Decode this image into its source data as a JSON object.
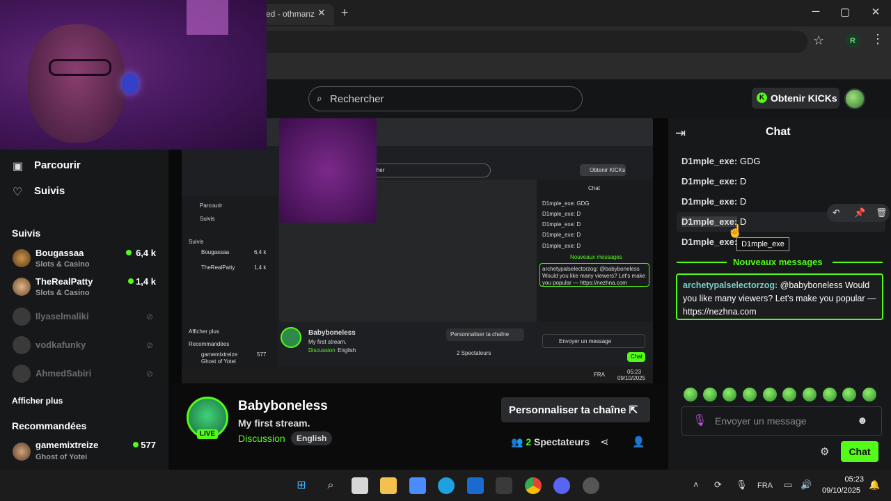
{
  "browser": {
    "tab_title": "ed - othmanz",
    "tab_close": "✕",
    "new_tab": "+",
    "minimize": "─",
    "maximize": "▢",
    "close": "✕",
    "profile_initial": "R"
  },
  "header": {
    "search_placeholder": "Rechercher",
    "kicks_button": "Obtenir KICKs",
    "kicks_icon_glyph": "K"
  },
  "sidebar": {
    "nav": [
      {
        "label": "Parcourir",
        "icon": "browse-icon"
      },
      {
        "label": "Suivis",
        "icon": "heart-icon"
      }
    ],
    "followed_title": "Suivis",
    "followed": [
      {
        "name": "Bougassaa",
        "category": "Slots & Casino",
        "viewers": "6,4 k",
        "live": true
      },
      {
        "name": "TheRealPatty",
        "category": "Slots & Casino",
        "viewers": "1,4 k",
        "live": true
      },
      {
        "name": "Ilyaselmaliki",
        "live": false
      },
      {
        "name": "vodkafunky",
        "live": false
      },
      {
        "name": "AhmedSabiri",
        "live": false
      }
    ],
    "show_more": "Afficher plus",
    "recommended_title": "Recommandées",
    "recommended": [
      {
        "name": "gamemixtreize",
        "category": "Ghost of Yotei",
        "viewers": "577",
        "live": true
      }
    ]
  },
  "channel": {
    "name": "Babyboneless",
    "stream_title": "My first stream.",
    "category": "Discussion",
    "language": "English",
    "live_badge": "LIVE",
    "customize_button": "Personnaliser ta chaîne",
    "viewers_count": "2",
    "viewers_label": "Spectateurs"
  },
  "chat": {
    "title": "Chat",
    "messages": [
      {
        "user": "D1mple_exe:",
        "text": "GDG"
      },
      {
        "user": "D1mple_exe:",
        "text": "D"
      },
      {
        "user": "D1mple_exe:",
        "text": "D"
      },
      {
        "user": "D1mple_exe:",
        "text": "D"
      },
      {
        "user": "D1mple_exe:",
        "text": "D"
      }
    ],
    "tooltip": "D1mple_exe",
    "new_messages_label": "Nouveaux messages",
    "pinned_user": "archetypalselectorzog:",
    "pinned_text": "@babyboneless Would you like many viewers? Let's make you popular — https://nezhna.com",
    "input_placeholder": "Envoyer un message",
    "send_button": "Chat"
  },
  "mini_stream": {
    "search": "Rechercher",
    "kicks": "Obtenir KICKs",
    "chat": "Chat",
    "browse": "Parcourir",
    "follow": "Suivis",
    "followed_title": "Suivis",
    "ch1": "Bougassaa",
    "ch1_v": "6,4 k",
    "ch2": "TheRealPatty",
    "ch2_v": "1,4 k",
    "show_more": "Afficher plus",
    "recommended": "Recommandées",
    "rec1": "gamemixtreize",
    "rec1_cat": "Ghost of Yotei",
    "rec1_v": "577",
    "msg1": "D1mple_exe: GDG",
    "msg2": "D1mple_exe: D",
    "new_msgs": "Nouveaux messages",
    "pinned": "archetypalselectorzog: @babyboneless Would you like many viewers? Let's make you popular — https://nezhna.com",
    "channel": "Babyboneless",
    "stream": "My first stream.",
    "category": "Discussion",
    "language": "English",
    "customize": "Personnaliser ta chaîne",
    "viewers": "2 Spectateurs",
    "input": "Envoyer un message",
    "send": "Chat",
    "lang": "FRA",
    "time": "05:23",
    "date": "09/10/2025"
  },
  "taskbar": {
    "lang": "FRA",
    "time": "05:23",
    "date": "09/10/2025"
  },
  "colors": {
    "kick_green": "#53fc18",
    "bg": "#0b0b0c",
    "panel": "#17181a"
  }
}
